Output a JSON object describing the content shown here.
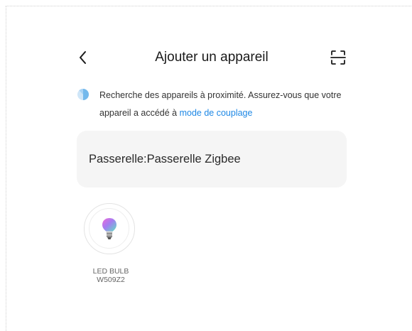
{
  "header": {
    "back_icon": "chevron-left-icon",
    "title": "Ajouter un appareil",
    "scan_icon": "scan-frame-icon"
  },
  "notice": {
    "icon": "loading-spinner-icon",
    "text_part1": "Recherche des appareils à proximité. Assurez-vous que votre appareil a accédé à ",
    "link_text": "mode de couplage"
  },
  "gateway": {
    "label": "Passerelle:Passerelle Zigbee"
  },
  "devices": [
    {
      "icon": "light-bulb-icon",
      "name_line1": "LED BULB",
      "name_line2": "W509Z2"
    }
  ],
  "colors": {
    "accent": "#1e88e5",
    "card_background": "#f5f5f5",
    "spinner": "#74b9ec"
  }
}
